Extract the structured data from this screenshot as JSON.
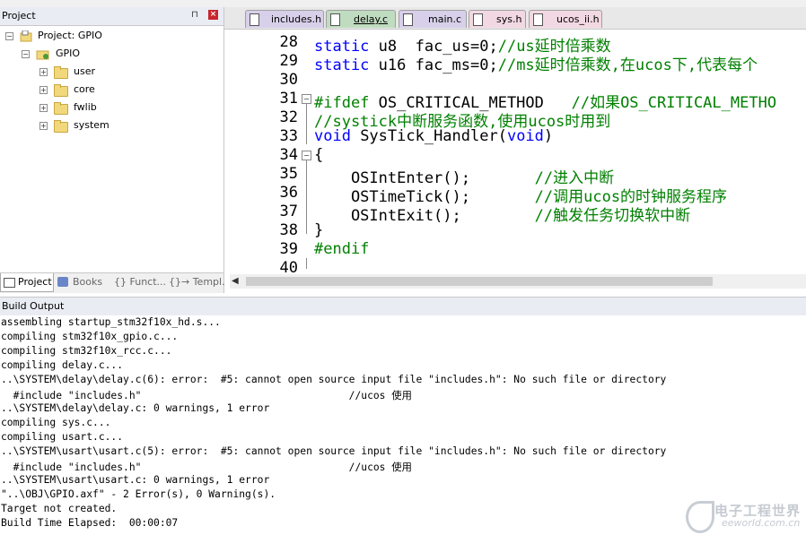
{
  "project_panel": {
    "title": "Project",
    "root": "Project: GPIO",
    "target": "GPIO",
    "groups": [
      "user",
      "core",
      "fwlib",
      "system"
    ],
    "bottom_tabs": [
      "Project",
      "Books",
      "{} Funct...",
      "{}→ Templ..."
    ]
  },
  "editor": {
    "tabs": [
      "includes.h",
      "delay.c",
      "main.c",
      "sys.h",
      "ucos_ii.h"
    ],
    "active_tab": "delay.c",
    "line_numbers": [
      "28",
      "29",
      "30",
      "31",
      "32",
      "33",
      "34",
      "35",
      "36",
      "37",
      "38",
      "39",
      "40"
    ],
    "lines": {
      "l28_kw": "static",
      "l28_code": " u8  fac_us=0;",
      "l28_cm": "//us延时倍乘数",
      "l29_kw": "static",
      "l29_code": " u16 fac_ms=0;",
      "l29_cm": "//ms延时倍乘数,在ucos下,代表每个",
      "l31_pp": "#ifdef",
      "l31_code": " OS_CRITICAL_METHOD   ",
      "l31_cm": "//如果OS_CRITICAL_METHO",
      "l32_cm": "//systick中断服务函数,使用ucos时用到",
      "l33_kw": "void",
      "l33_code": " SysTick_Handler(",
      "l33_kw2": "void",
      "l33_end": ")",
      "l34": "{",
      "l35_code": "    OSIntEnter();       ",
      "l35_cm": "//进入中断",
      "l36_code": "    OSTimeTick();       ",
      "l36_cm": "//调用ucos的时钟服务程序",
      "l37_code": "    OSIntExit();        ",
      "l37_cm": "//触发任务切换软中断",
      "l38": "}",
      "l39_pp": "#endif"
    }
  },
  "build_output": {
    "title": "Build Output",
    "lines": [
      "assembling startup_stm32f10x_hd.s...",
      "compiling stm32f10x_gpio.c...",
      "compiling stm32f10x_rcc.c...",
      "compiling delay.c...",
      "..\\SYSTEM\\delay\\delay.c(6): error:  #5: cannot open source input file \"includes.h\": No such file or directory",
      "  #include \"includes.h\"                                  //ucos 使用",
      "..\\SYSTEM\\delay\\delay.c: 0 warnings, 1 error",
      "compiling sys.c...",
      "compiling usart.c...",
      "..\\SYSTEM\\usart\\usart.c(5): error:  #5: cannot open source input file \"includes.h\": No such file or directory",
      "  #include \"includes.h\"                                  //ucos 使用",
      "..\\SYSTEM\\usart\\usart.c: 0 warnings, 1 error",
      "\"..\\OBJ\\GPIO.axf\" - 2 Error(s), 0 Warning(s).",
      "Target not created.",
      "Build Time Elapsed:  00:00:07"
    ]
  },
  "watermark": {
    "cn": "电子工程世界",
    "en": "eeworld.com.cn"
  },
  "colors": {
    "keyword": "#0000ff",
    "comment": "#008000",
    "active_tab": "#c0dcc0"
  }
}
